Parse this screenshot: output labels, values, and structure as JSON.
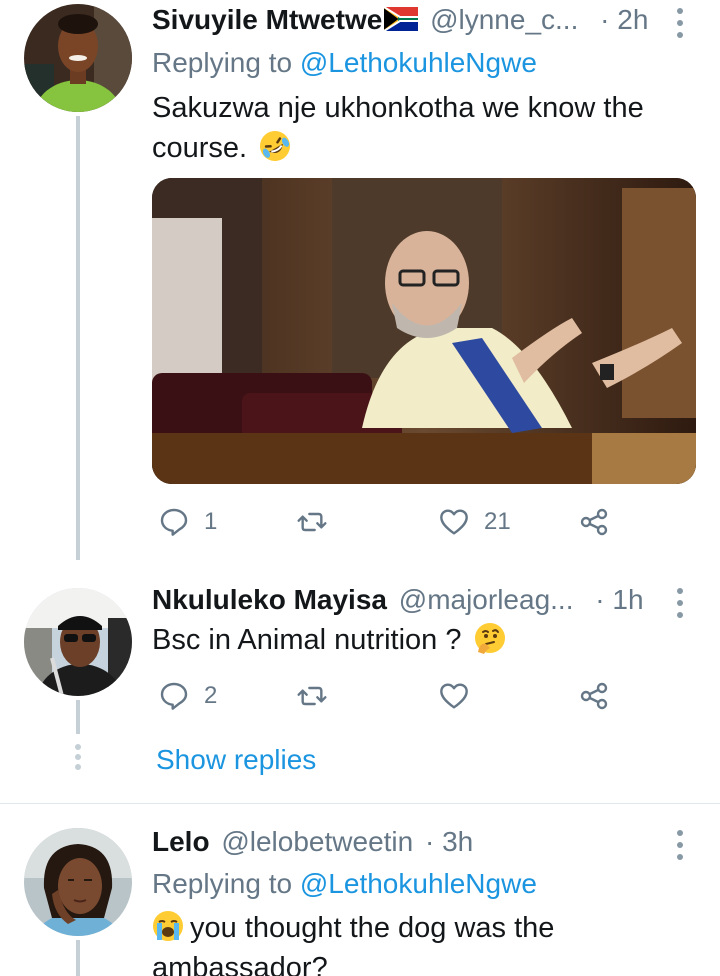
{
  "tweets": [
    {
      "name": "Sivuyile Mtwetwe",
      "handle": "@lynne_c...",
      "dot": "·",
      "time": "2h",
      "replying_prefix": "Replying to",
      "replying_mention": "@LethokuhleNgwe",
      "text": "Sakuzwa nje ukhonkotha we know the course.",
      "text_emoji": "rolling-on-floor-laughing-emoji",
      "has_flag": "south-africa-flag",
      "has_media": true,
      "reply_count": "1",
      "retweet_count": "",
      "like_count": "21"
    },
    {
      "name": "Nkululeko Mayisa",
      "handle": "@majorleag...",
      "dot": "·",
      "time": "1h",
      "text": "Bsc in Animal nutrition ?",
      "text_emoji": "thinking-face-emoji",
      "reply_count": "2",
      "retweet_count": "",
      "like_count": ""
    },
    {
      "name": "Lelo",
      "handle": "@lelobetweetin",
      "dot": "·",
      "time": "3h",
      "replying_prefix": "Replying to",
      "replying_mention": "@LethokuhleNgwe",
      "text": "you thought the dog was the ambassador?",
      "text_emoji": "loudly-crying-face-emoji"
    }
  ],
  "show_replies": "Show replies",
  "colors": {
    "accent": "#1b95e0",
    "secondary_text": "#657786",
    "thread_line": "#c4cfd6",
    "divider": "#e1e8ed"
  }
}
